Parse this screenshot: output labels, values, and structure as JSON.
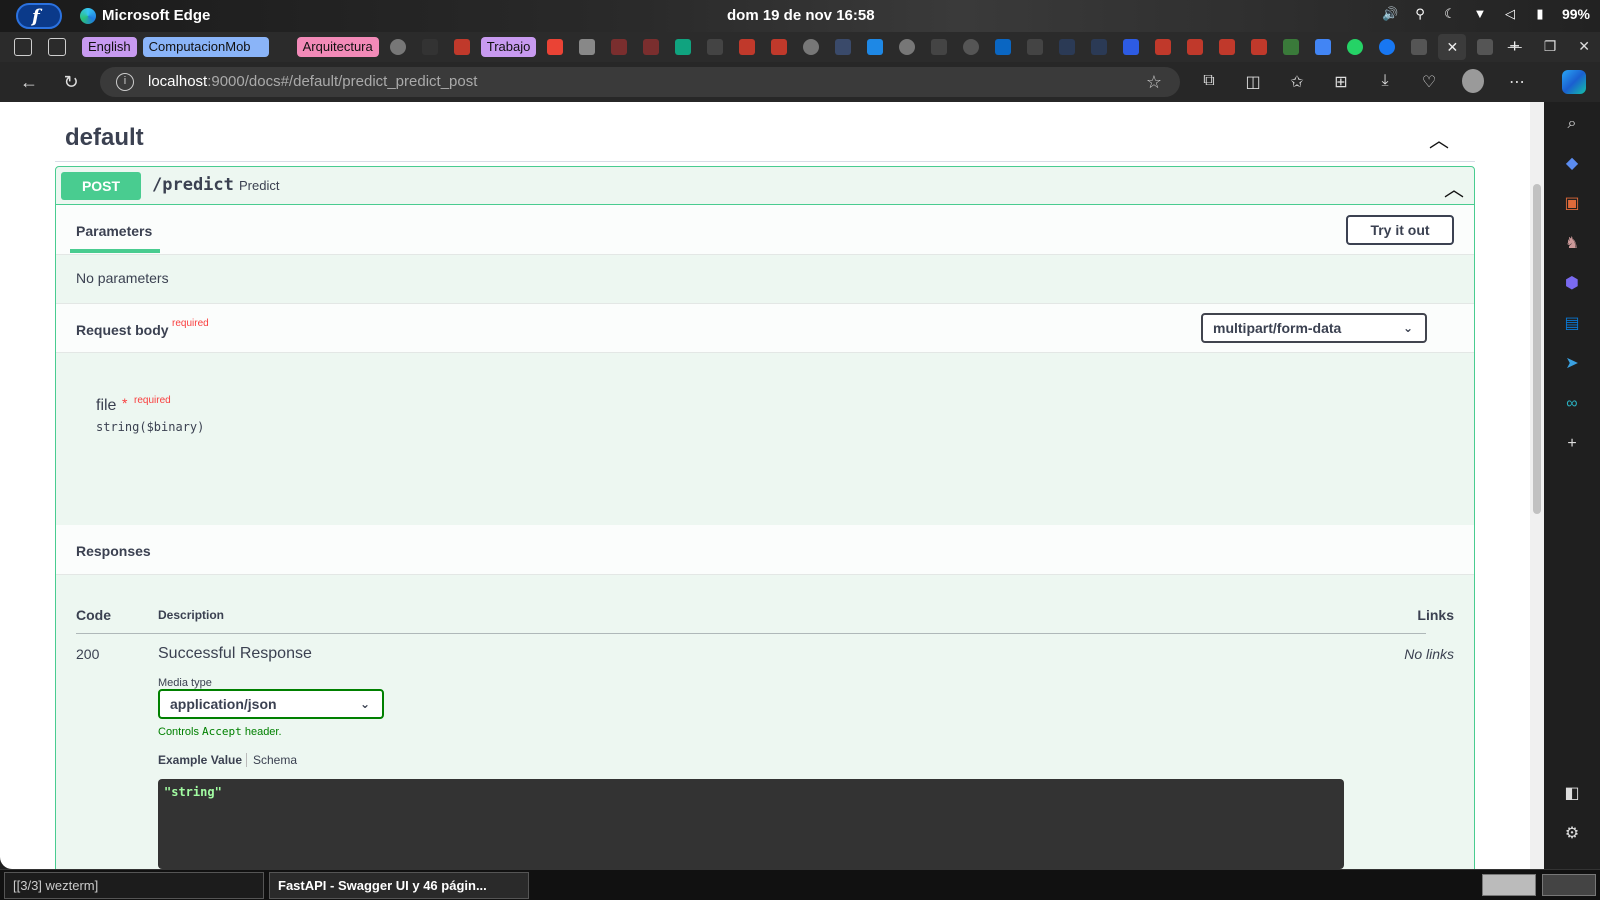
{
  "system": {
    "app_name": "Microsoft Edge",
    "clock": "dom 19 de nov  16:58",
    "battery": "99%"
  },
  "tabs": {
    "groups": [
      {
        "label": "English",
        "color": "#c89af0"
      },
      {
        "label": "ComputacionMob",
        "color": "#8ab4f8"
      },
      {
        "label": "Arquitectura",
        "color": "#f28ab8"
      },
      {
        "label": "Trabajo",
        "color": "#c89af0"
      }
    ]
  },
  "address_bar": {
    "host": "localhost",
    "path": ":9000/docs#/default/predict_predict_post"
  },
  "swagger": {
    "tag": "default",
    "operation": {
      "method": "POST",
      "path": "/predict",
      "summary": "Predict"
    },
    "parameters_tab": "Parameters",
    "try_it_out": "Try it out",
    "no_parameters": "No parameters",
    "request_body": {
      "title": "Request body",
      "required": "required",
      "content_type": "multipart/form-data",
      "field_name": "file",
      "field_star": "*",
      "field_required": "required",
      "field_type": "string($binary)"
    },
    "responses": {
      "title": "Responses",
      "columns": {
        "code": "Code",
        "description": "Description",
        "links": "Links"
      },
      "rows": [
        {
          "code": "200",
          "description": "Successful Response",
          "links": "No links",
          "media_type_label": "Media type",
          "media_type": "application/json",
          "controls_prefix": "Controls ",
          "controls_code": "Accept",
          "controls_suffix": " header.",
          "example_tab": "Example Value",
          "schema_tab": "Schema",
          "example": "\"string\""
        }
      ]
    }
  },
  "taskbar": {
    "terminal": "[[3/3] wezterm]",
    "edge": "FastAPI - Swagger UI y 46 págin..."
  }
}
